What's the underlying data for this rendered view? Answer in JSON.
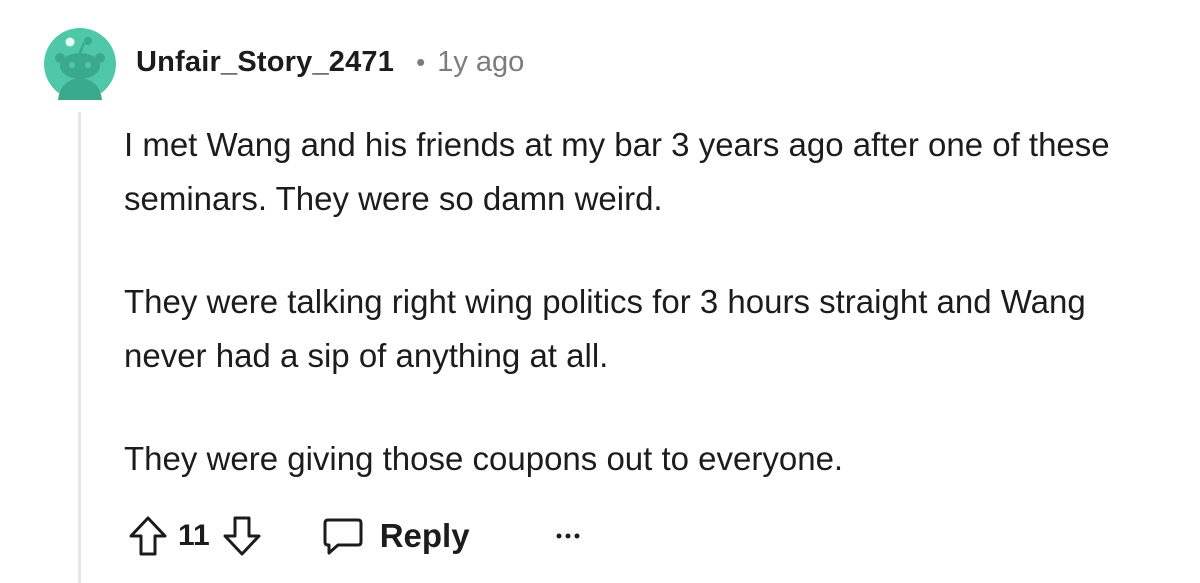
{
  "comment": {
    "author": "Unfair_Story_2471",
    "separator": "•",
    "timestamp": "1y ago",
    "paragraphs": [
      "I met Wang and his friends at my bar 3 years ago after one of these seminars. They were so damn weird.",
      "They were talking right wing politics for 3 hours straight and Wang never had a sip of anything at all.",
      "They were giving those coupons out to everyone."
    ]
  },
  "actions": {
    "vote_count": "11",
    "reply_label": "Reply",
    "upvote_icon": "arrow-up-outline-icon",
    "downvote_icon": "arrow-down-outline-icon",
    "reply_icon": "speech-bubble-icon",
    "more_icon": "ellipsis-icon"
  },
  "colors": {
    "avatar_background": "#4fc8a8",
    "text": "#1c1c1c",
    "meta_text": "#7c7c7c",
    "thread_line": "#e5e7e9"
  }
}
